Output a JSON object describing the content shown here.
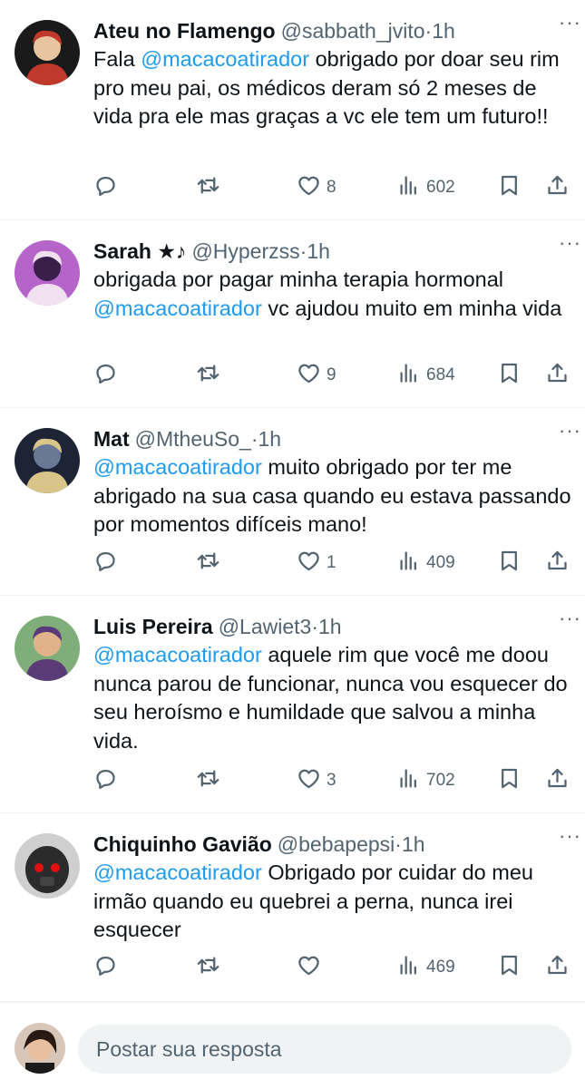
{
  "tweets": [
    {
      "name": "Ateu no Flamengo",
      "handle": "@sabbath_jvito",
      "sep": "·",
      "time": "1h",
      "text_parts": [
        {
          "t": "Fala ",
          "m": false
        },
        {
          "t": "@macacoatirador",
          "m": true
        },
        {
          "t": " obrigado por doar seu rim pro meu pai, os médicos deram só 2 meses de vida pra ele mas graças a vc ele tem um futuro!!",
          "m": false
        }
      ],
      "likes": "8",
      "views": "602",
      "avatar_colors": [
        "#1a1a1a",
        "#c0392b",
        "#e8c4a0"
      ]
    },
    {
      "name": "Sarah ★♪",
      "handle": "@Hyperzss",
      "sep": "·",
      "time": "1h",
      "text_parts": [
        {
          "t": "obrigada por pagar minha terapia hormonal ",
          "m": false
        },
        {
          "t": "@macacoatirador",
          "m": true
        },
        {
          "t": " vc ajudou muito em minha vida",
          "m": false
        }
      ],
      "likes": "9",
      "views": "684",
      "avatar_colors": [
        "#b565c9",
        "#f0e0f0",
        "#3a1f4a"
      ]
    },
    {
      "name": "Mat",
      "handle": "@MtheuSo_",
      "sep": "·",
      "time": "1h",
      "text_parts": [
        {
          "t": "@macacoatirador",
          "m": true
        },
        {
          "t": " muito obrigado por ter me abrigado na sua casa quando eu estava passando por momentos difíceis mano!",
          "m": false
        }
      ],
      "likes": "1",
      "views": "409",
      "avatar_colors": [
        "#1c2436",
        "#d9c48a",
        "#6a7896"
      ]
    },
    {
      "name": "Luis Pereira",
      "handle": "@Lawiet3",
      "sep": "·",
      "time": "1h",
      "text_parts": [
        {
          "t": "@macacoatirador",
          "m": true
        },
        {
          "t": " aquele rim que você me doou nunca parou de funcionar, nunca vou esquecer do seu heroísmo e humildade que salvou a minha vida.",
          "m": false
        }
      ],
      "likes": "3",
      "views": "702",
      "avatar_colors": [
        "#7fae7a",
        "#5b3a78",
        "#e0b38a"
      ]
    },
    {
      "name": "Chiquinho Gavião",
      "handle": "@bebapepsi",
      "sep": "·",
      "time": "1h",
      "text_parts": [
        {
          "t": "@macacoatirador",
          "m": true
        },
        {
          "t": " Obrigado por cuidar do meu irmão quando eu quebrei a perna, nunca irei esquecer",
          "m": false
        }
      ],
      "likes": "",
      "views": "469",
      "avatar_colors": [
        "#cfcfcf",
        "#2b2b2b",
        "#e01010"
      ]
    }
  ],
  "reply": {
    "placeholder": "Postar sua resposta"
  },
  "colors": {
    "mention": "#1d9bf0",
    "secondary_text": "#536471",
    "divider": "#eff3f4"
  }
}
